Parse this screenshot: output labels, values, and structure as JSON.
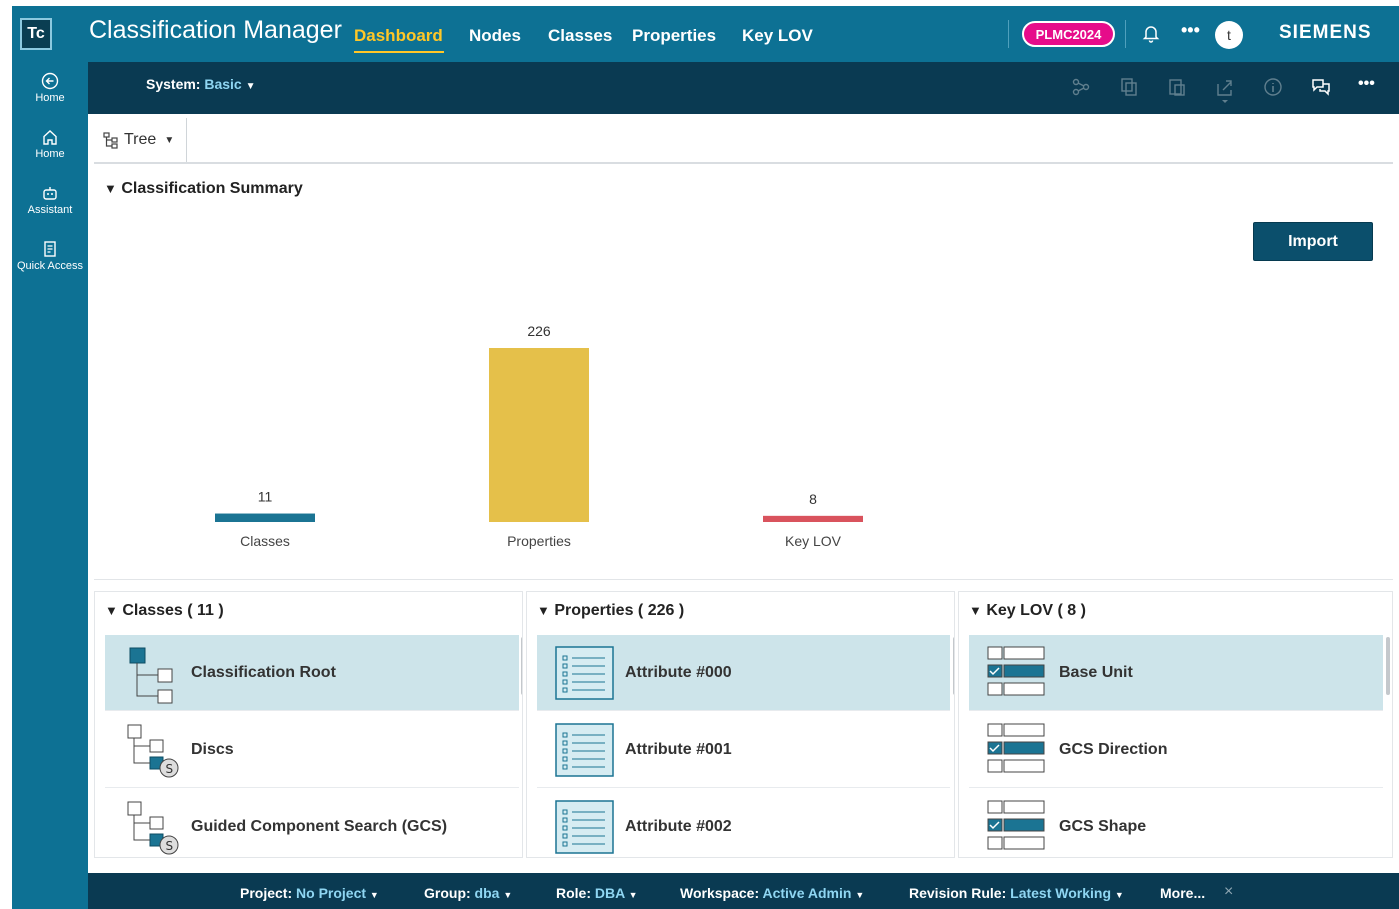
{
  "app": {
    "logo": "Tc",
    "title": "Classification Manager",
    "brand": "SIEMENS",
    "badge": "PLMC2024",
    "avatar_initial": "t",
    "more": "•••"
  },
  "nav_tabs": [
    {
      "label": "Dashboard",
      "active": true
    },
    {
      "label": "Nodes",
      "active": false
    },
    {
      "label": "Classes",
      "active": false
    },
    {
      "label": "Properties",
      "active": false
    },
    {
      "label": "Key LOV",
      "active": false
    }
  ],
  "rail": [
    {
      "label": "Home",
      "icon": "back-arrow-icon"
    },
    {
      "label": "Home",
      "icon": "home-icon"
    },
    {
      "label": "Assistant",
      "icon": "assistant-icon"
    },
    {
      "label": "Quick Access",
      "icon": "quick-access-icon"
    }
  ],
  "system_bar": {
    "label": "System:",
    "value": "Basic",
    "more": "•••"
  },
  "tree_toggle": {
    "label": "Tree"
  },
  "summary": {
    "title": "Classification Summary",
    "import_label": "Import"
  },
  "chart_data": {
    "type": "bar",
    "categories": [
      "Classes",
      "Properties",
      "Key LOV"
    ],
    "values": [
      11,
      226,
      8
    ],
    "colors": [
      "#1b7493",
      "#e5c04a",
      "#d9535d"
    ],
    "data_labels": true,
    "legend": "none",
    "grid": false
  },
  "classes_panel": {
    "title": "Classes ( 11 )",
    "items": [
      {
        "label": "Classification Root",
        "selected": true,
        "icon": "class-root-icon"
      },
      {
        "label": "Discs",
        "selected": false,
        "icon": "storage-class-icon"
      },
      {
        "label": "Guided Component Search (GCS)",
        "selected": false,
        "icon": "storage-class-icon"
      }
    ]
  },
  "properties_panel": {
    "title": "Properties ( 226 )",
    "items": [
      {
        "label": "Attribute #000",
        "selected": true,
        "icon": "attribute-icon"
      },
      {
        "label": "Attribute #001",
        "selected": false,
        "icon": "attribute-icon"
      },
      {
        "label": "Attribute #002",
        "selected": false,
        "icon": "attribute-icon"
      }
    ]
  },
  "keylov_panel": {
    "title": "Key LOV ( 8 )",
    "items": [
      {
        "label": "Base Unit",
        "selected": true,
        "icon": "key-lov-icon"
      },
      {
        "label": "GCS Direction",
        "selected": false,
        "icon": "key-lov-icon"
      },
      {
        "label": "GCS Shape",
        "selected": false,
        "icon": "key-lov-icon"
      }
    ]
  },
  "footer": {
    "project_label": "Project:",
    "project_value": "No Project",
    "group_label": "Group:",
    "group_value": "dba",
    "role_label": "Role:",
    "role_value": "DBA",
    "workspace_label": "Workspace:",
    "workspace_value": "Active Admin",
    "revision_label": "Revision Rule:",
    "revision_value": "Latest Working",
    "more_label": "More...",
    "close": "×"
  }
}
